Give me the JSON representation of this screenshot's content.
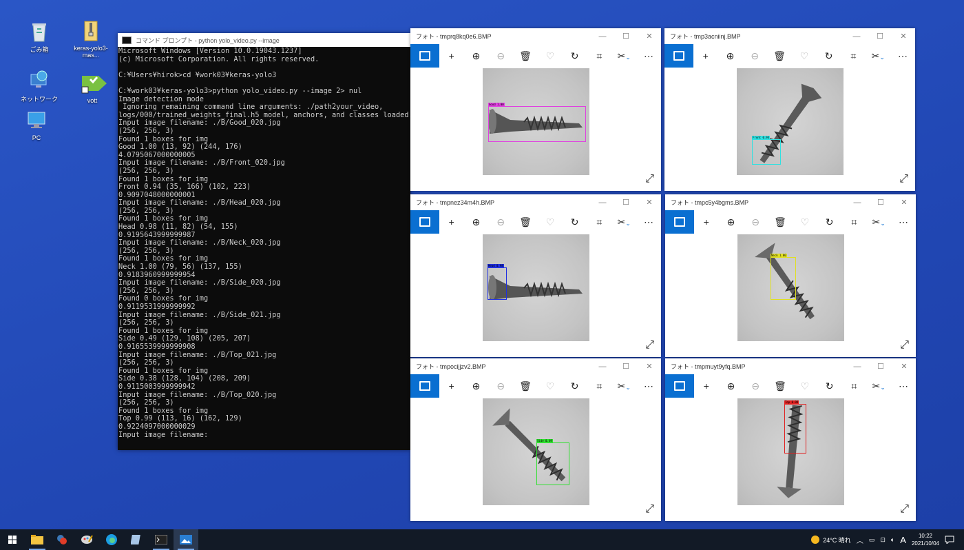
{
  "desktop": {
    "icons": [
      {
        "label": "ごみ箱"
      },
      {
        "label": "keras-yolo3-mas..."
      },
      {
        "label": "ネットワーク"
      },
      {
        "label": "vott"
      },
      {
        "label": "PC"
      }
    ]
  },
  "console": {
    "title": "コマンド プロンプト - python  yolo_video.py --image",
    "text": "Microsoft Windows [Version 10.0.19043.1237]\n(c) Microsoft Corporation. All rights reserved.\n\nC:¥Users¥hirok>cd ¥work03¥keras-yolo3\n\nC:¥work03¥keras-yolo3>python yolo_video.py --image 2> nul\nImage detection mode\n Ignoring remaining command line arguments: ./path2your_video,\nlogs/000/trained_weights_final.h5 model, anchors, and classes loaded.\nInput image filename: ./B/Good_020.jpg\n(256, 256, 3)\nFound 1 boxes for img\nGood 1.00 (13, 92) (244, 176)\n4.0795067000000005\nInput image filename: ./B/Front_020.jpg\n(256, 256, 3)\nFound 1 boxes for img\nFront 0.94 (35, 166) (102, 223)\n0.9097048000000001\nInput image filename: ./B/Head_020.jpg\n(256, 256, 3)\nFound 1 boxes for img\nHead 0.98 (11, 82) (54, 155)\n0.9195643999999987\nInput image filename: ./B/Neck_020.jpg\n(256, 256, 3)\nFound 1 boxes for img\nNeck 1.00 (79, 56) (137, 155)\n0.9183960999999954\nInput image filename: ./B/Side_020.jpg\n(256, 256, 3)\nFound 0 boxes for img\n0.9119531999999992\nInput image filename: ./B/Side_021.jpg\n(256, 256, 3)\nFound 1 boxes for img\nSide 0.49 (129, 108) (205, 207)\n0.9165539999999908\nInput image filename: ./B/Top_021.jpg\n(256, 256, 3)\nFound 1 boxes for img\nSide 0.38 (128, 104) (208, 209)\n0.9115003999999942\nInput image filename: ./B/Top_020.jpg\n(256, 256, 3)\nFound 1 boxes for img\nTop 0.99 (113, 16) (162, 129)\n0.9224097000000029\nInput image filename:"
  },
  "photos": [
    {
      "title": "フォト - tmprq8kq0e6.BMP",
      "label": "Good 1.00",
      "color": "#e040e0"
    },
    {
      "title": "フォト - tmp3acniinj.BMP",
      "label": "Front 0.94",
      "color": "#30e0e0"
    },
    {
      "title": "フォト - tmpnez34m4h.BMP",
      "label": "Head 0.98",
      "color": "#2030e0"
    },
    {
      "title": "フォト - tmpc5y4bgms.BMP",
      "label": "Neck 1.00",
      "color": "#e0e020"
    },
    {
      "title": "フォト - tmpocijjzv2.BMP",
      "label": "Side 0.49",
      "color": "#30e030"
    },
    {
      "title": "フォト - tmpmuyt9yfq.BMP",
      "label": "Top 0.99",
      "color": "#e02020"
    }
  ],
  "window_controls": {
    "minimize": "—",
    "maximize": "☐",
    "close": "✕"
  },
  "taskbar": {
    "weather": "24°C  晴れ",
    "ime": "A",
    "time": "10:22",
    "date": "2021/10/04"
  }
}
